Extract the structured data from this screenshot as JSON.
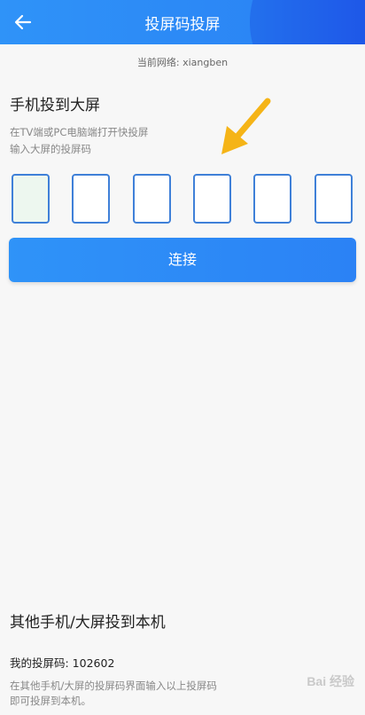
{
  "header": {
    "title": "投屏码投屏",
    "back_icon": "arrow-left-icon"
  },
  "network": {
    "label": "当前网络: xiangben"
  },
  "cast_to_screen": {
    "title": "手机投到大屏",
    "desc_line1": "在TV端或PC电脑端打开快投屏",
    "desc_line2": "输入大屏的投屏码",
    "code_boxes": [
      "",
      "",
      "",
      "",
      "",
      ""
    ],
    "connect_label": "连接"
  },
  "cast_to_me": {
    "title": "其他手机/大屏投到本机",
    "my_code": "我的投屏码: 102602",
    "desc_line1": "在其他手机/大屏的投屏码界面输入以上投屏码",
    "desc_line2": "即可投屏到本机。"
  },
  "watermark": "Bai 经验",
  "colors": {
    "primary": "#2f93f8",
    "box_border": "#3f80d8",
    "arrow": "#f5b417"
  }
}
